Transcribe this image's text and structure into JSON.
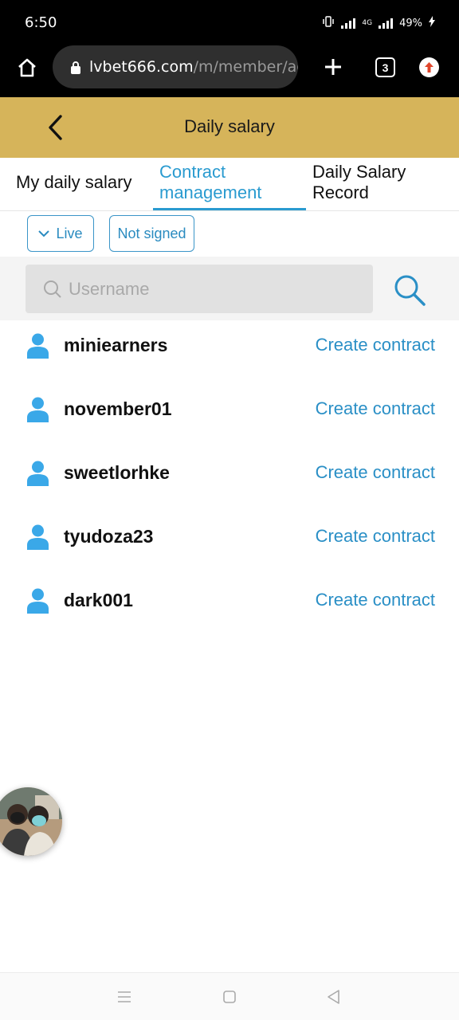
{
  "status_bar": {
    "time": "6:50",
    "network": "4G",
    "battery": "49%"
  },
  "browser": {
    "url_host": "lvbet666.com",
    "url_path": "/m/member/ag",
    "tab_count": "3"
  },
  "header": {
    "title": "Daily salary"
  },
  "tabs": [
    {
      "label": "My daily salary",
      "active": false
    },
    {
      "label": "Contract management",
      "active": true
    },
    {
      "label": "Daily Salary Record",
      "active": false
    }
  ],
  "filters": {
    "live_label": "Live",
    "sign_label": "Not signed"
  },
  "search": {
    "placeholder": "Username",
    "value": ""
  },
  "users": [
    {
      "name": "miniearners",
      "action": "Create contract"
    },
    {
      "name": "november01",
      "action": "Create contract"
    },
    {
      "name": "sweetlorhke",
      "action": "Create contract"
    },
    {
      "name": "tyudoza23",
      "action": "Create contract"
    },
    {
      "name": "dark001",
      "action": "Create contract"
    }
  ],
  "colors": {
    "header_bg": "#d6b45a",
    "accent": "#2a9bd0",
    "user_icon": "#3aa8e8"
  },
  "icons": {
    "home": "home-icon",
    "lock": "lock-icon",
    "new_tab": "plus-icon",
    "update": "update-icon",
    "back": "chevron-left-icon",
    "filter_dropdown": "chevron-down-icon",
    "search": "search-icon",
    "user": "user-icon"
  }
}
